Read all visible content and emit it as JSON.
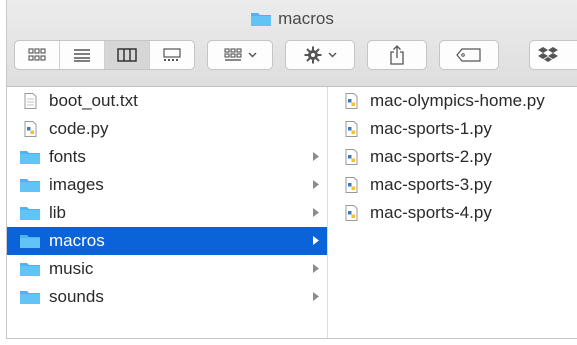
{
  "window": {
    "title": "macros"
  },
  "toolbar": {
    "views": [
      "icon-view",
      "list-view",
      "column-view",
      "gallery-view"
    ],
    "active_view": "column-view",
    "group_button": "group-icon",
    "action_button": "gear-icon",
    "share_button": "share-icon",
    "tag_button": "tag-icon",
    "dropbox_button": "dropbox-icon"
  },
  "left_column": [
    {
      "label": "boot_out.txt",
      "kind": "text"
    },
    {
      "label": "code.py",
      "kind": "python"
    },
    {
      "label": "fonts",
      "kind": "folder"
    },
    {
      "label": "images",
      "kind": "folder"
    },
    {
      "label": "lib",
      "kind": "folder"
    },
    {
      "label": "macros",
      "kind": "folder",
      "selected": true
    },
    {
      "label": "music",
      "kind": "folder"
    },
    {
      "label": "sounds",
      "kind": "folder"
    }
  ],
  "right_column": [
    {
      "label": "mac-olympics-home.py",
      "kind": "python"
    },
    {
      "label": "mac-sports-1.py",
      "kind": "python"
    },
    {
      "label": "mac-sports-2.py",
      "kind": "python"
    },
    {
      "label": "mac-sports-3.py",
      "kind": "python"
    },
    {
      "label": "mac-sports-4.py",
      "kind": "python"
    }
  ],
  "colors": {
    "selection": "#0a63d9",
    "folder": "#4cb4ef"
  }
}
